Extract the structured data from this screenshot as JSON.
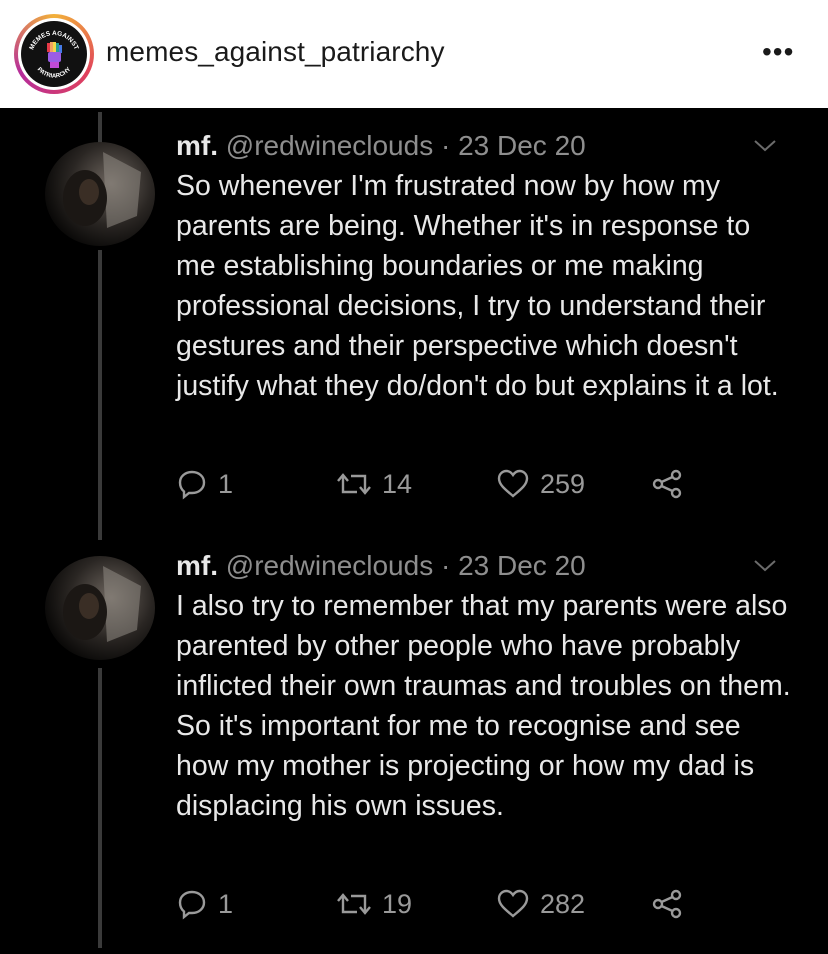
{
  "header": {
    "account_name": "memes_against_patriarchy",
    "avatar_text_top": "MEMES AGAINST",
    "avatar_text_bottom": "PATRIARCHY",
    "more_label": "•••"
  },
  "tweets": [
    {
      "display_name": "mf.",
      "handle": "@redwineclouds",
      "separator": "·",
      "date": "23 Dec 20",
      "text": "So whenever I'm frustrated now by how my parents are being. Whether it's in response to me establishing boundaries or me making professional decisions, I try to understand their gestures and their perspective which doesn't justify what they do/don't do but explains it a lot.",
      "replies": "1",
      "retweets": "14",
      "likes": "259"
    },
    {
      "display_name": "mf.",
      "handle": "@redwineclouds",
      "separator": "·",
      "date": "23 Dec 20",
      "text": "I also try to remember that my parents were also parented by other people who have probably inflicted their own traumas and troubles on them. So it's important for me to recognise and see how my mother is projecting or how my dad is displacing his own issues.",
      "replies": "1",
      "retweets": "19",
      "likes": "282"
    }
  ],
  "colors": {
    "background": "#000000",
    "text": "#e8e8e8",
    "muted": "#8e8e8e",
    "thread_line": "#3a3a3a"
  }
}
